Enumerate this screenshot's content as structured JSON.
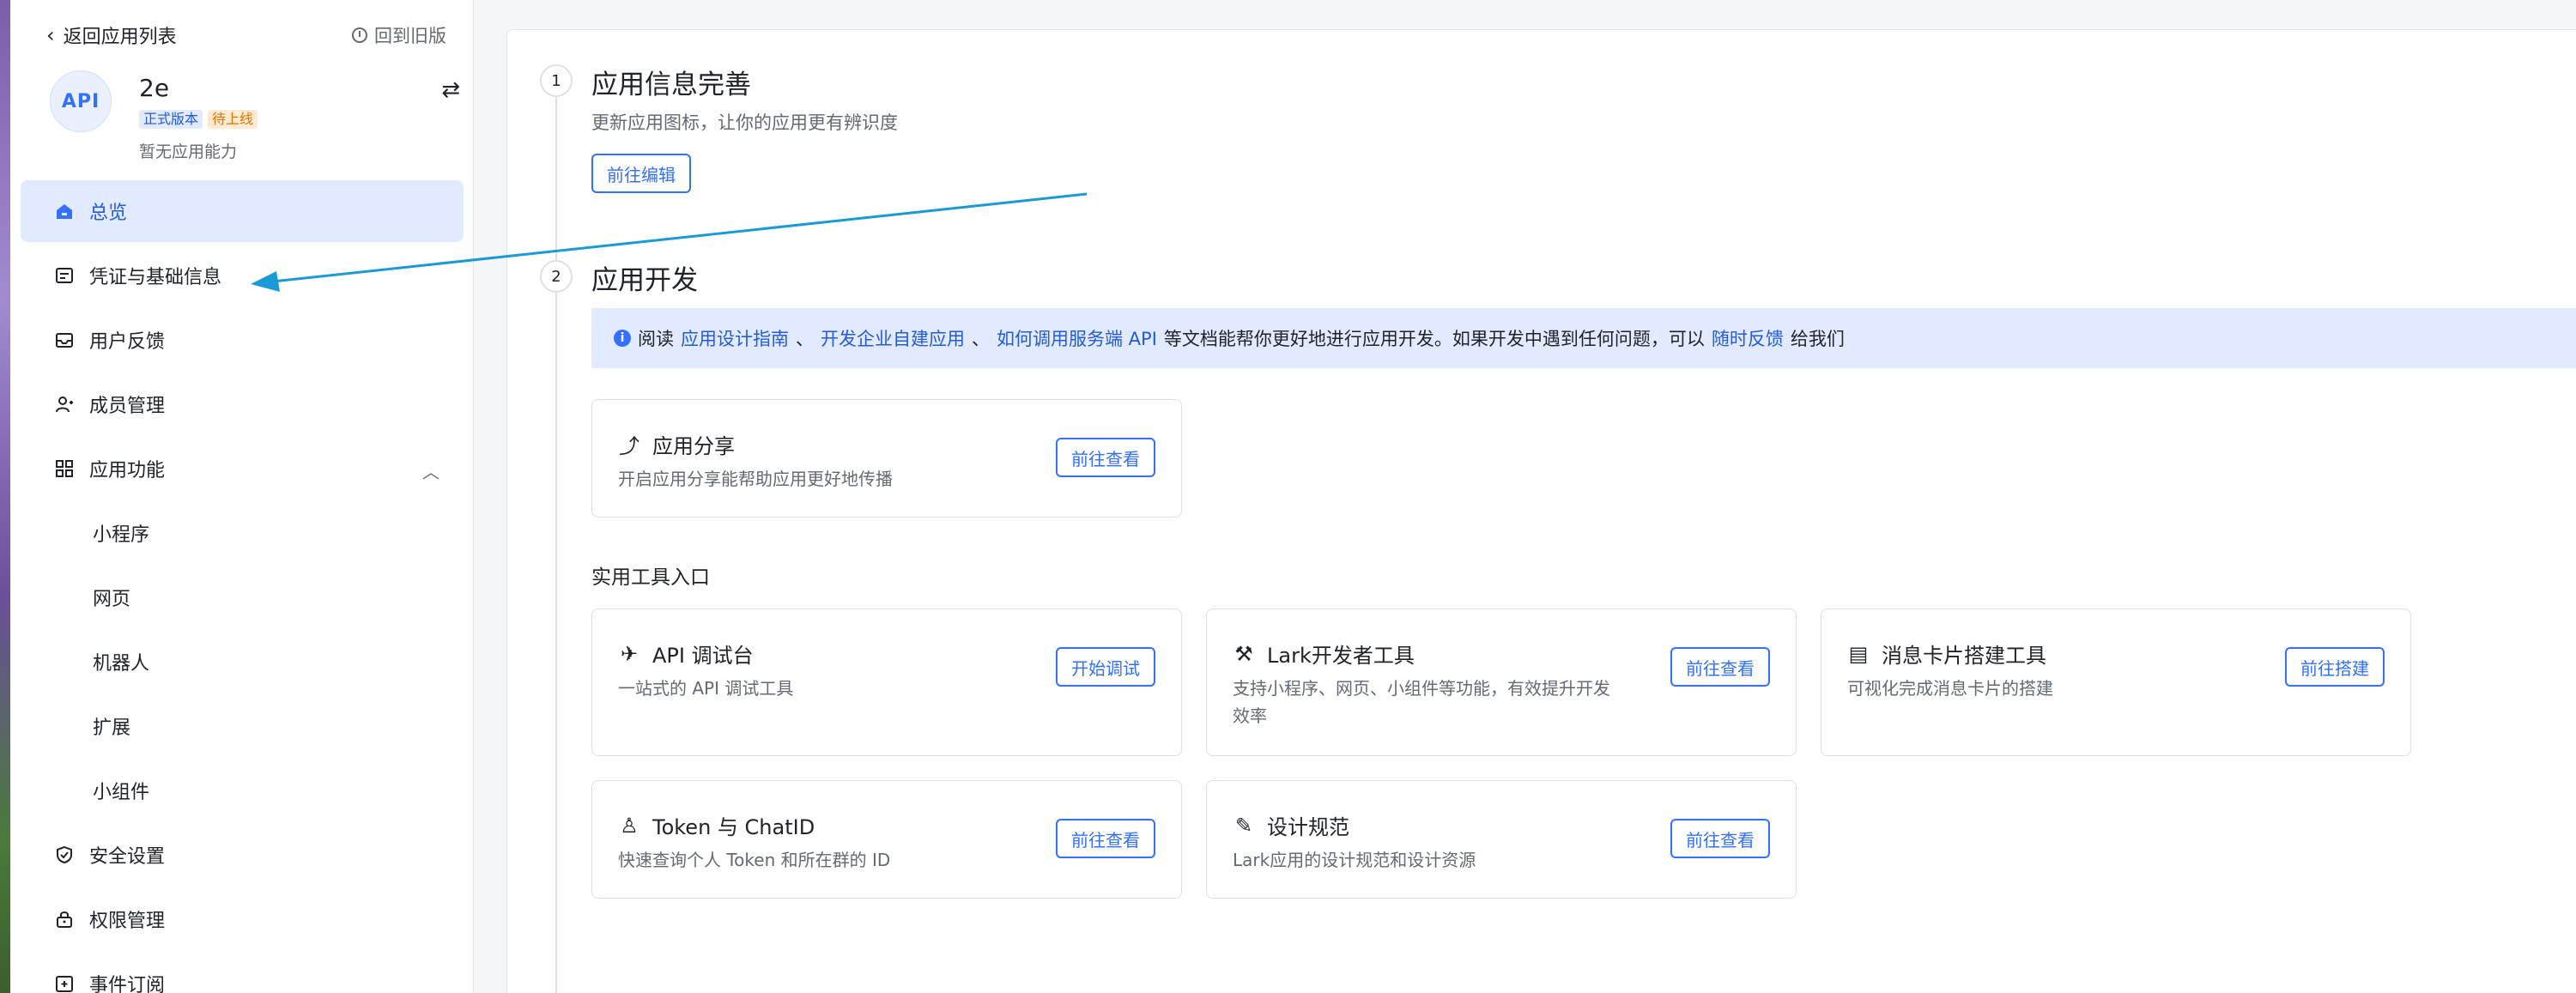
{
  "sidebar": {
    "back_label": "返回应用列表",
    "old_version_label": "回到旧版",
    "app": {
      "avatar_text": "API",
      "name": "2e",
      "badge_release": "正式版本",
      "badge_pending": "待上线",
      "description": "暂无应用能力"
    },
    "nav": [
      {
        "label": "总览",
        "icon": "home-icon"
      },
      {
        "label": "凭证与基础信息",
        "icon": "credential-icon"
      },
      {
        "label": "用户反馈",
        "icon": "inbox-icon"
      },
      {
        "label": "成员管理",
        "icon": "user-add-icon"
      },
      {
        "label": "应用功能",
        "icon": "apps-grid-icon"
      },
      {
        "label": "小程序"
      },
      {
        "label": "网页"
      },
      {
        "label": "机器人"
      },
      {
        "label": "扩展"
      },
      {
        "label": "小组件"
      },
      {
        "label": "安全设置",
        "icon": "shield-icon"
      },
      {
        "label": "权限管理",
        "icon": "lock-icon"
      },
      {
        "label": "事件订阅",
        "icon": "event-icon"
      }
    ]
  },
  "main": {
    "step1": {
      "num": "1",
      "title": "应用信息完善",
      "subtitle": "更新应用图标，让你的应用更有辨识度",
      "button": "前往编辑"
    },
    "step2": {
      "num": "2",
      "title": "应用开发",
      "info": {
        "prefix": "阅读",
        "link1": "应用设计指南",
        "sep1": "、",
        "link2": "开发企业自建应用",
        "sep2": "、",
        "link3": "如何调用服务端 API",
        "middle": "等文档能帮你更好地进行应用开发。如果开发中遇到任何问题，可以",
        "link4": "随时反馈",
        "suffix": "给我们"
      },
      "share_card": {
        "title": "应用分享",
        "desc": "开启应用分享能帮助应用更好地传播",
        "button": "前往查看"
      },
      "tools_label": "实用工具入口",
      "tools": [
        {
          "title": "API 调试台",
          "desc": "一站式的 API 调试工具",
          "button": "开始调试"
        },
        {
          "title": "Lark开发者工具",
          "desc_line1": "支持小程序、网页、小组件等功能，有效提升开发",
          "desc_line2": "效率",
          "button": "前往查看"
        },
        {
          "title": "消息卡片搭建工具",
          "desc": "可视化完成消息卡片的搭建",
          "button": "前往搭建"
        },
        {
          "title": "Token 与 ChatID",
          "desc": "快速查询个人 Token 和所在群的 ID",
          "button": "前往查看"
        },
        {
          "title": "设计规范",
          "desc": "Lark应用的设计规范和设计资源",
          "button": "前往查看"
        }
      ]
    }
  },
  "colors": {
    "accent": "#3370ff",
    "active_bg": "#e1eaff",
    "annotation_arrow": "#1a9ad6"
  }
}
